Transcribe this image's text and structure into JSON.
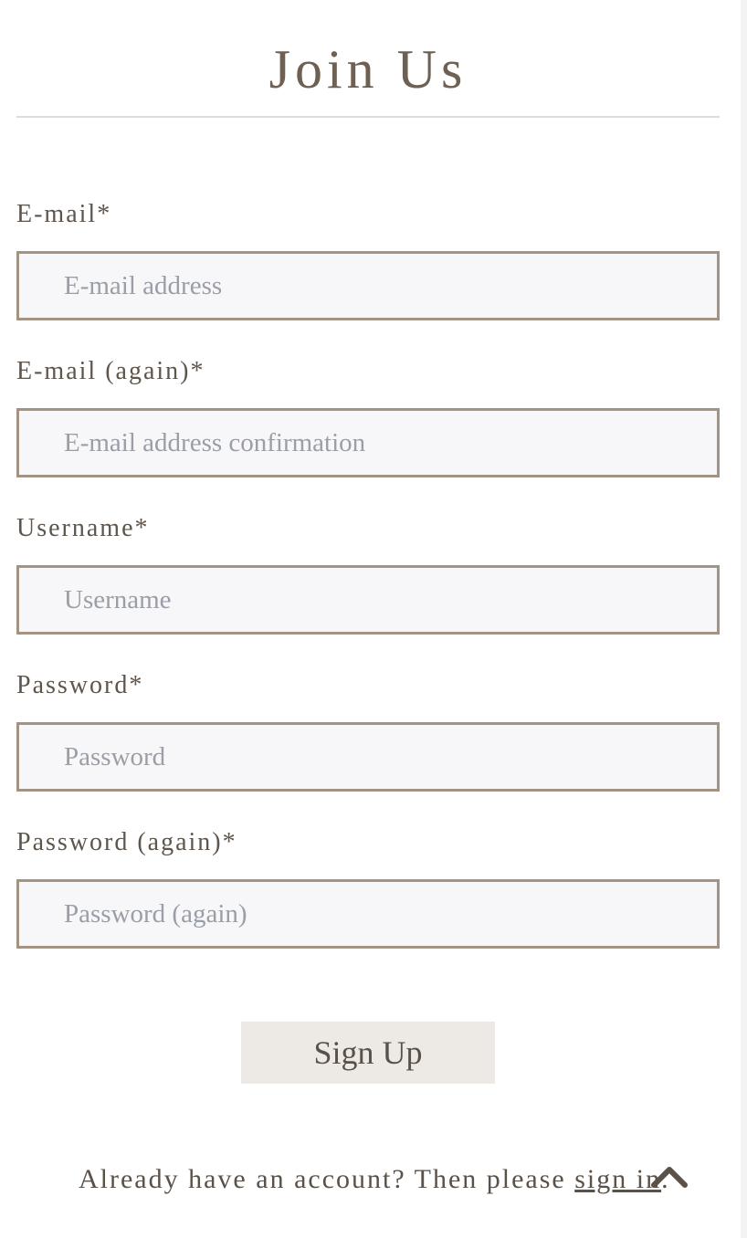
{
  "header": {
    "title": "Join Us"
  },
  "form": {
    "fields": [
      {
        "label": "E-mail*",
        "placeholder": "E-mail address",
        "value": ""
      },
      {
        "label": "E-mail (again)*",
        "placeholder": "E-mail address confirmation",
        "value": ""
      },
      {
        "label": "Username*",
        "placeholder": "Username",
        "value": ""
      },
      {
        "label": "Password*",
        "placeholder": "Password",
        "value": ""
      },
      {
        "label": "Password (again)*",
        "placeholder": "Password (again)",
        "value": ""
      }
    ],
    "submit_label": "Sign Up"
  },
  "footer": {
    "prompt": "Already have an account? Then please ",
    "link_text": "sign in",
    "suffix": "."
  },
  "icons": {
    "back_to_top": "chevron-up-icon"
  },
  "colors": {
    "text": "#5a5148",
    "input_border": "#a39382",
    "input_bg": "#f7f7f9",
    "button_bg": "#ede9e4"
  }
}
